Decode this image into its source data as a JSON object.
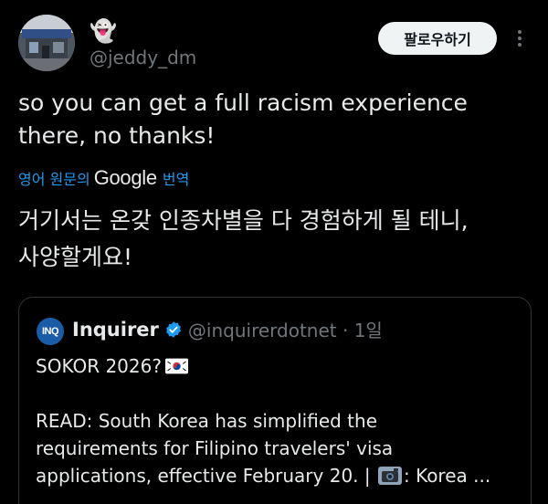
{
  "author": {
    "display_name": "👻",
    "handle": "@jeddy_dm"
  },
  "follow_label": "팔로우하기",
  "tweet": {
    "text": "so you can get a full racism experience there, no thanks!",
    "translate_prefix": "영어 원문의",
    "translate_google": "Google",
    "translate_suffix": "번역",
    "translated_line1": "거기서는 온갖 인종차별을 다 경험하게 될 테니,",
    "translated_line2": "사양할게요!"
  },
  "quote": {
    "avatar_text": "INQ",
    "name": "Inquirer",
    "handle_time": "@inquirerdotnet · 1일",
    "line1": "SOKOR 2026?",
    "body_line1": "READ: South Korea has simplified the",
    "body_line2": "requirements for Filipino travelers' visa",
    "body_line3_a": "applications, effective February 20. | ",
    "body_line3_b": ": Korea ..."
  },
  "colors": {
    "background": "#000000",
    "text": "#e7e9ea",
    "muted": "#71767b",
    "link": "#1d9bf0",
    "border": "#2f3336",
    "verified": "#1d9bf0"
  }
}
